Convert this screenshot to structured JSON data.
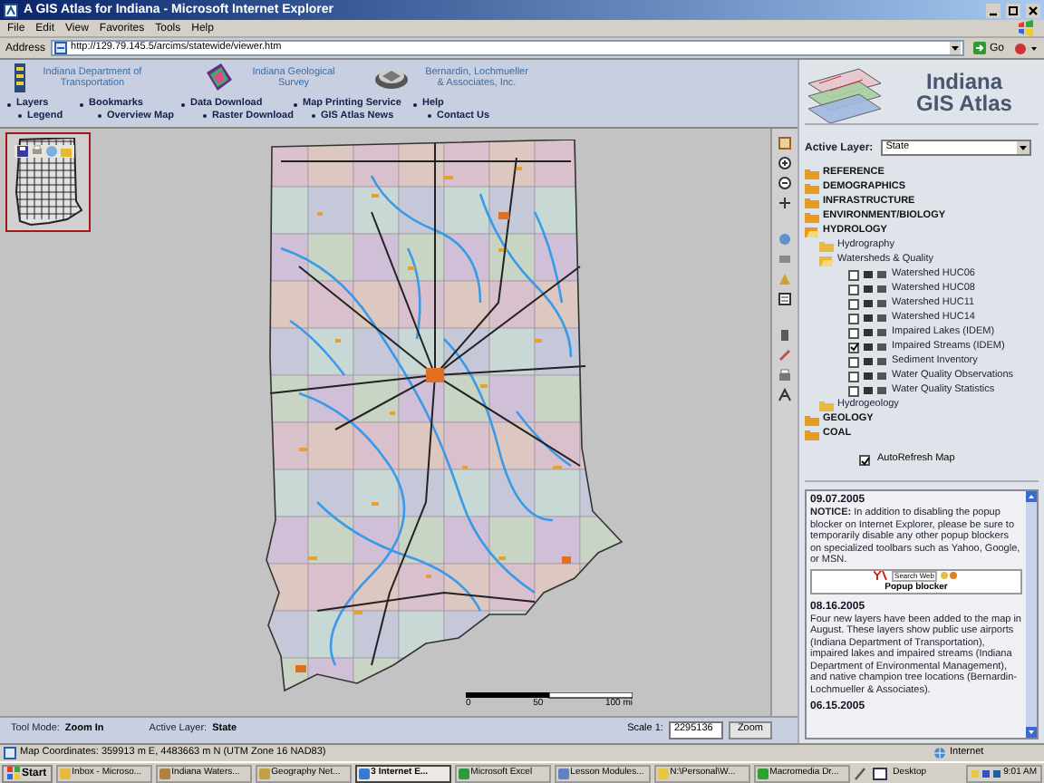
{
  "window": {
    "title": "A GIS Atlas for Indiana - Microsoft Internet Explorer"
  },
  "menu": [
    "File",
    "Edit",
    "View",
    "Favorites",
    "Tools",
    "Help"
  ],
  "address_bar": {
    "label": "Address",
    "url": "http://129.79.145.5/arcims/statewide/viewer.htm",
    "go": "Go"
  },
  "header": {
    "partners": [
      "Indiana Department of Transportation",
      "Indiana Geological Survey",
      "Bernardin, Lochmueller & Associates, Inc."
    ],
    "logo_lines": [
      "Indiana",
      "GIS Atlas"
    ]
  },
  "nav_rows": [
    [
      "Layers",
      "Bookmarks",
      "Data Download",
      "Map Printing Service",
      "Help"
    ],
    [
      "Legend",
      "Overview Map",
      "Raster Download",
      "GIS Atlas News",
      "Contact Us"
    ]
  ],
  "map": {
    "scale_labels": [
      "0",
      "50",
      "100 mi"
    ]
  },
  "bottom_bar": {
    "tool_mode_label": "Tool Mode:",
    "tool_mode": "Zoom In",
    "active_layer_label": "Active Layer:",
    "active_layer": "State",
    "scale_label": "Scale 1:",
    "scale": "2295136",
    "zoom_button": "Zoom"
  },
  "side_panel": {
    "active_layer_label": "Active Layer:",
    "active_layer": "State",
    "tree": [
      {
        "kind": "folder",
        "label": "REFERENCE",
        "expanded": false
      },
      {
        "kind": "folder",
        "label": "DEMOGRAPHICS",
        "expanded": false
      },
      {
        "kind": "folder",
        "label": "INFRASTRUCTURE",
        "expanded": false
      },
      {
        "kind": "folder",
        "label": "ENVIRONMENT/BIOLOGY",
        "expanded": false
      },
      {
        "kind": "folder",
        "label": "HYDROLOGY",
        "expanded": true,
        "children": [
          {
            "kind": "folder",
            "label": "Hydrography",
            "expanded": false
          },
          {
            "kind": "folder",
            "label": "Watersheds & Quality",
            "expanded": true,
            "children": [
              {
                "kind": "layer",
                "label": "Watershed HUC06",
                "checked": false
              },
              {
                "kind": "layer",
                "label": "Watershed HUC08",
                "checked": false
              },
              {
                "kind": "layer",
                "label": "Watershed HUC11",
                "checked": false
              },
              {
                "kind": "layer",
                "label": "Watershed HUC14",
                "checked": false
              },
              {
                "kind": "layer",
                "label": "Impaired Lakes (IDEM)",
                "checked": false
              },
              {
                "kind": "layer",
                "label": "Impaired Streams (IDEM)",
                "checked": true
              },
              {
                "kind": "layer",
                "label": "Sediment Inventory",
                "checked": false
              },
              {
                "kind": "layer",
                "label": "Water Quality Observations",
                "checked": false
              },
              {
                "kind": "layer",
                "label": "Water Quality Statistics",
                "checked": false
              }
            ]
          },
          {
            "kind": "folder",
            "label": "Hydrogeology",
            "expanded": false
          }
        ]
      },
      {
        "kind": "folder",
        "label": "GEOLOGY",
        "expanded": false
      },
      {
        "kind": "folder",
        "label": "COAL",
        "expanded": false
      }
    ],
    "autorefresh": {
      "label": "AutoRefresh Map",
      "checked": true
    },
    "news": [
      {
        "date": "09.07.2005",
        "text": "**NOTICE:** In addition to disabling the popup blocker on Internet Explorer, please be sure to temporarily disable any other popup blockers on specialized toolbars such as Yahoo, Google, or MSN.",
        "image": {
          "search": "Search Web",
          "caption": "Popup blocker"
        }
      },
      {
        "date": "08.16.2005",
        "text": "Four new layers have been added to the map in August. These layers show public use airports (Indiana Department of Transportation), impaired lakes and impaired streams (Indiana Department of Environmental Management), and native champion tree locations (Bernardin-Lochmueller & Associates)."
      },
      {
        "date": "06.15.2005"
      }
    ]
  },
  "status_bar": {
    "text": "Map Coordinates: 359913 m E, 4483663 m N (UTM Zone 16 NAD83)",
    "zone": "Internet"
  },
  "taskbar": {
    "start": "Start",
    "tasks": [
      {
        "label": "Inbox - Microso...",
        "selected": false
      },
      {
        "label": "Indiana Waters...",
        "selected": false
      },
      {
        "label": "Geography Net...",
        "selected": false
      },
      {
        "label": "3 Internet E...",
        "selected": true
      },
      {
        "label": "Microsoft Excel",
        "selected": false
      },
      {
        "label": "Lesson Modules...",
        "selected": false
      },
      {
        "label": "N:\\Personal\\W...",
        "selected": false
      },
      {
        "label": "Macromedia Dr...",
        "selected": false
      }
    ],
    "tray_label": "Desktop",
    "time": "9:01 AM"
  }
}
